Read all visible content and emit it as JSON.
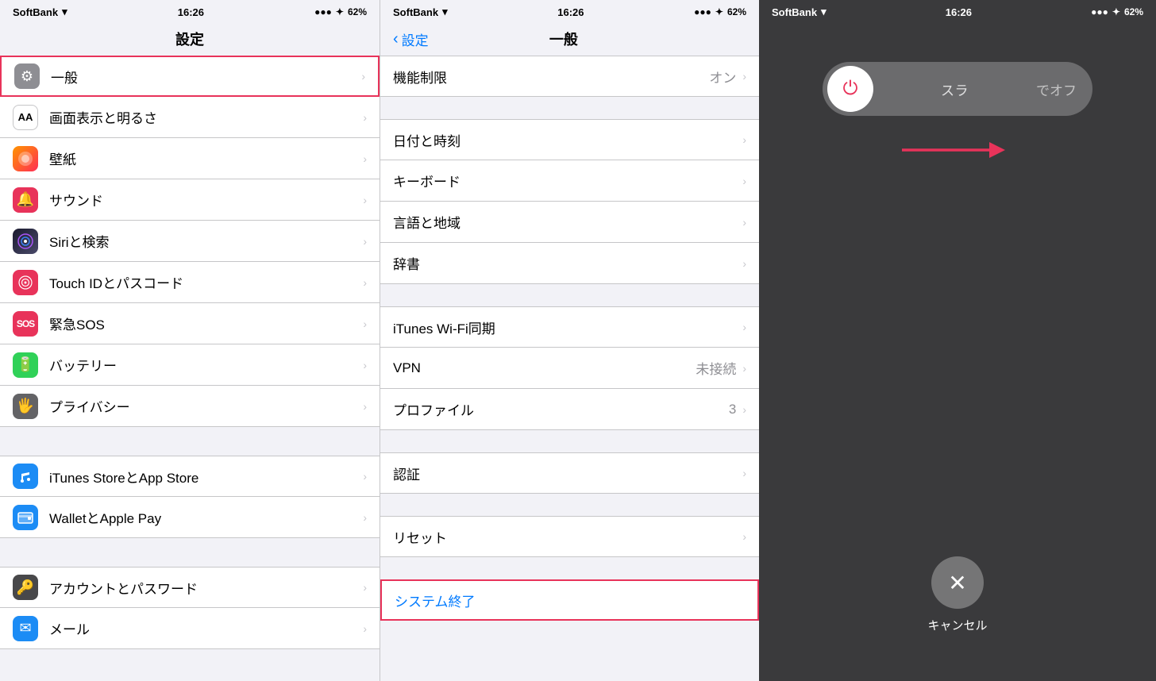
{
  "panel1": {
    "status_bar": {
      "carrier": "SoftBank",
      "time": "16:26",
      "battery": "62%"
    },
    "title": "設定",
    "items": [
      {
        "id": "general",
        "label": "一般",
        "icon": "gear",
        "highlighted": true
      },
      {
        "id": "display",
        "label": "画面表示と明るさ",
        "icon": "aa"
      },
      {
        "id": "wallpaper",
        "label": "壁紙",
        "icon": "wallpaper"
      },
      {
        "id": "sound",
        "label": "サウンド",
        "icon": "sound"
      },
      {
        "id": "siri",
        "label": "Siriと検索",
        "icon": "siri"
      },
      {
        "id": "touchid",
        "label": "Touch IDとパスコード",
        "icon": "touch"
      },
      {
        "id": "sos",
        "label": "緊急SOS",
        "icon": "sos"
      },
      {
        "id": "battery",
        "label": "バッテリー",
        "icon": "battery"
      },
      {
        "id": "privacy",
        "label": "プライバシー",
        "icon": "privacy"
      },
      {
        "id": "itunes",
        "label": "iTunes StoreとApp Store",
        "icon": "itunes"
      },
      {
        "id": "wallet",
        "label": "WalletとApple Pay",
        "icon": "wallet"
      },
      {
        "id": "account",
        "label": "アカウントとパスワード",
        "icon": "account"
      },
      {
        "id": "mail",
        "label": "メール",
        "icon": "mail"
      }
    ]
  },
  "panel2": {
    "status_bar": {
      "carrier": "SoftBank",
      "time": "16:26",
      "battery": "62%"
    },
    "back_label": "設定",
    "title": "一般",
    "items": [
      {
        "id": "restrictions",
        "label": "機能制限",
        "value": "オン",
        "has_value": true
      },
      {
        "id": "datetime",
        "label": "日付と時刻",
        "value": "",
        "has_value": false
      },
      {
        "id": "keyboard",
        "label": "キーボード",
        "value": "",
        "has_value": false
      },
      {
        "id": "language",
        "label": "言語と地域",
        "value": "",
        "has_value": false
      },
      {
        "id": "dictionary",
        "label": "辞書",
        "value": "",
        "has_value": false
      },
      {
        "id": "itunes_wifi",
        "label": "iTunes Wi-Fi同期",
        "value": "",
        "has_value": false
      },
      {
        "id": "vpn",
        "label": "VPN",
        "value": "未接続",
        "has_value": true
      },
      {
        "id": "profile",
        "label": "プロファイル",
        "value": "3",
        "has_value": true
      },
      {
        "id": "auth",
        "label": "認証",
        "value": "",
        "has_value": false
      },
      {
        "id": "reset",
        "label": "リセット",
        "value": "",
        "has_value": false
      },
      {
        "id": "shutdown",
        "label": "システム終了",
        "value": "",
        "has_value": false,
        "blue": true,
        "highlighted": true
      }
    ]
  },
  "panel3": {
    "status_bar": {
      "carrier": "SoftBank",
      "time": "16:26",
      "battery": "62%"
    },
    "slider": {
      "label": "スラ",
      "off_label": "でオフ"
    },
    "cancel_label": "キャンセル"
  }
}
